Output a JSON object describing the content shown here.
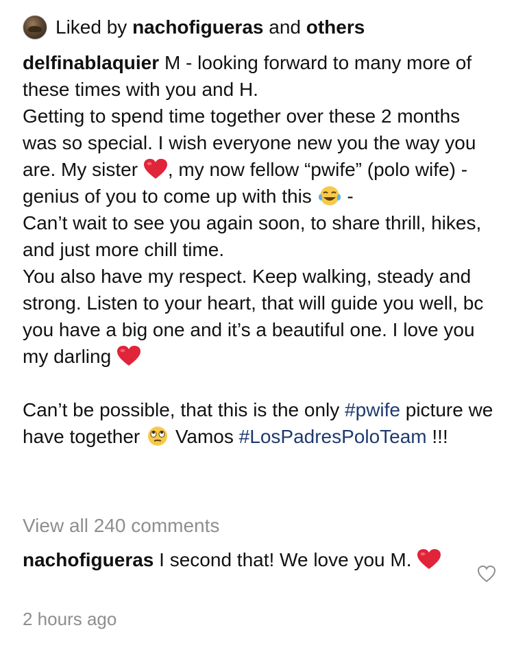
{
  "likes": {
    "prefix": "Liked by",
    "user": "nachofigueras",
    "middle": "and",
    "suffix": "others"
  },
  "caption": {
    "author": "delfinablaquier",
    "line1_rest": "M - looking forward to many more of these times with you and H.",
    "para2_a": "Getting to spend time together over these 2 months was so special. I wish everyone new you the way you are. My sister",
    "para2_b": ", my now fellow “pwife” (polo wife) -genius of you to come up with this",
    "para2_c": "-",
    "para3": "Can’t wait to see you again soon, to share thrill, hikes, and just more chill time.",
    "para4": "You also have my respect. Keep walking, steady and strong. Listen to your heart, that will guide you well, bc you have a big one and it’s a beautiful one. I love you my darling",
    "para5_a": "Can’t be possible, that this is the only",
    "hashtag1": "#pwife",
    "para5_b": "picture we have together",
    "para5_c": "Vamos",
    "hashtag2": "#LosPadresPoloTeam",
    "para5_d": "!!!"
  },
  "view_all_comments": "View all 240 comments",
  "comment": {
    "author": "nachofigueras",
    "text": "I second that! We love you M."
  },
  "timestamp": "2 hours ago",
  "colors": {
    "hashtag": "#1e3a6e",
    "muted": "#8e8e8e",
    "heart_emoji": "#e0243a"
  },
  "icons": {
    "heart_emoji": "red-heart",
    "laugh_emoji": "face-with-tears-of-joy",
    "eyeroll_emoji": "face-with-rolling-eyes",
    "like_icon": "heart-outline-icon"
  }
}
